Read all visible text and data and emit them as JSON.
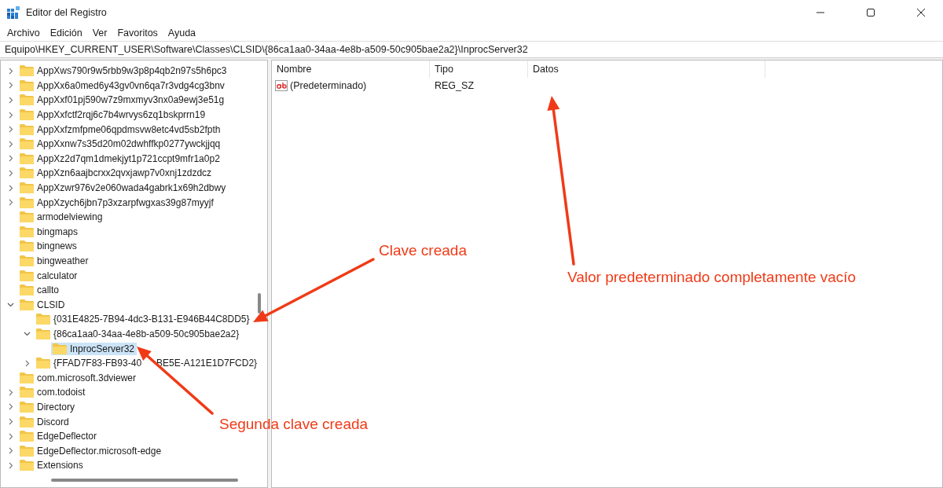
{
  "window": {
    "title": "Editor del Registro"
  },
  "menu": [
    "Archivo",
    "Edición",
    "Ver",
    "Favoritos",
    "Ayuda"
  ],
  "address": "Equipo\\HKEY_CURRENT_USER\\Software\\Classes\\CLSID\\{86ca1aa0-34aa-4e8b-a509-50c905bae2a2}\\InprocServer32",
  "tree": [
    {
      "label": "AppXws790r9w5rbb9w3p8p4qb2n97s5h6pc3",
      "expanded": false,
      "selected": false
    },
    {
      "label": "AppXx6a0med6y43gv0vn6qa7r3vdg4cg3bnv",
      "expanded": false,
      "selected": false
    },
    {
      "label": "AppXxf01pj590w7z9mxmyv3nx0a9ewj3e51g",
      "expanded": false,
      "selected": false
    },
    {
      "label": "AppXxfctf2rqj6c7b4wrvys6zq1bskprrn19",
      "expanded": false,
      "selected": false
    },
    {
      "label": "AppXxfzmfpme06qpdmsvw8etc4vd5sb2fpth",
      "expanded": false,
      "selected": false
    },
    {
      "label": "AppXxnw7s35d20m02dwhffkp0277ywckjjqq",
      "expanded": false,
      "selected": false
    },
    {
      "label": "AppXz2d7qm1dmekjyt1p721ccpt9mfr1a0p2",
      "expanded": false,
      "selected": false
    },
    {
      "label": "AppXzn6aajbcrxx2qvxjawp7v0xnj1zdzdcz",
      "expanded": false,
      "selected": false
    },
    {
      "label": "AppXzwr976v2e060wada4gabrk1x69h2dbwy",
      "expanded": false,
      "selected": false
    },
    {
      "label": "AppXzych6jbn7p3xzarpfwgxas39g87myyjf",
      "expanded": false,
      "selected": false
    },
    {
      "label": "armodelviewing",
      "selected": false
    },
    {
      "label": "bingmaps",
      "selected": false
    },
    {
      "label": "bingnews",
      "selected": false
    },
    {
      "label": "bingweather",
      "selected": false
    },
    {
      "label": "calculator",
      "selected": false
    },
    {
      "label": "callto",
      "selected": false
    },
    {
      "label": "CLSID",
      "expanded": true,
      "selected": false,
      "children": [
        {
          "label": "{031E4825-7B94-4dc3-B131-E946B44C8DD5}",
          "selected": false
        },
        {
          "label": "{86ca1aa0-34aa-4e8b-a509-50c905bae2a2}",
          "expanded": true,
          "selected": false,
          "children": [
            {
              "label": "InprocServer32",
              "selected": true
            }
          ]
        },
        {
          "label": "{FFAD7F83-FB93-40",
          "label_tail": "BE5E-A121E1D7FCD2}",
          "expanded": false,
          "selected": false
        }
      ]
    },
    {
      "label": "com.microsoft.3dviewer",
      "selected": false
    },
    {
      "label": "com.todoist",
      "expanded": false,
      "selected": false
    },
    {
      "label": "Directory",
      "expanded": false,
      "selected": false
    },
    {
      "label": "Discord",
      "expanded": false,
      "selected": false
    },
    {
      "label": "EdgeDeflector",
      "expanded": false,
      "selected": false
    },
    {
      "label": "EdgeDeflector.microsoft-edge",
      "expanded": false,
      "selected": false
    },
    {
      "label": "Extensions",
      "expanded": false,
      "selected": false
    }
  ],
  "columns": [
    "Nombre",
    "Tipo",
    "Datos"
  ],
  "values": [
    {
      "name": "(Predeterminado)",
      "type": "REG_SZ"
    }
  ],
  "annotations": [
    {
      "text": "Clave creada",
      "kind": "key"
    },
    {
      "text": "Valor predeterminado completamente vacío",
      "kind": "value"
    },
    {
      "text": "Segunda clave creada",
      "kind": "subkey"
    }
  ]
}
